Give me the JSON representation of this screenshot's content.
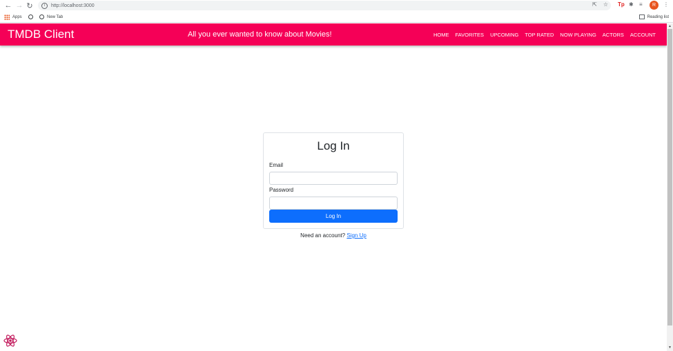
{
  "browser": {
    "url": "http://localhost:3000",
    "bookmarks": [
      "Apps",
      "New Tab"
    ],
    "reading_list": "Reading list",
    "avatar_letter": "R",
    "ext_label": "Tp"
  },
  "header": {
    "brand": "TMDB Client",
    "tagline": "All you ever wanted to know about Movies!",
    "nav": [
      "HOME",
      "FAVORITES",
      "UPCOMING",
      "TOP RATED",
      "NOW PLAYING",
      "ACTORS",
      "ACCOUNT"
    ]
  },
  "login": {
    "title": "Log In",
    "email_label": "Email",
    "email_value": "",
    "password_label": "Password",
    "password_value": "",
    "submit": "Log In",
    "signup_prompt": "Need an account?",
    "signup_link": "Sign Up"
  },
  "colors": {
    "header": "#f50057",
    "button": "#0d6efd"
  }
}
